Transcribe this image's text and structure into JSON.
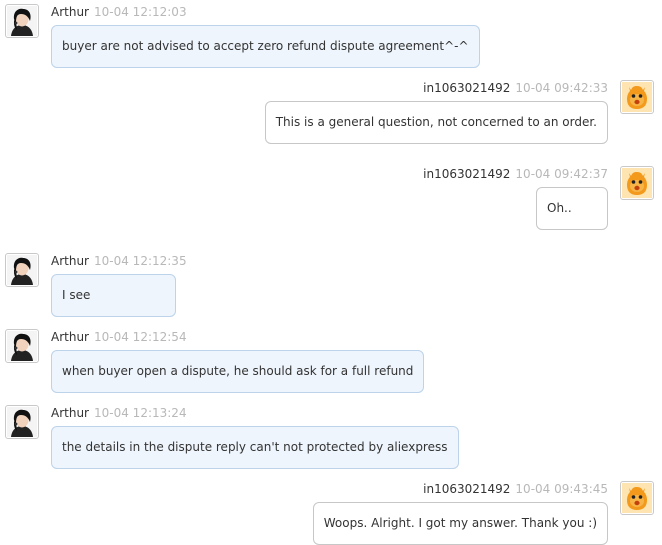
{
  "messages": [
    {
      "side": "left",
      "sender": "Arthur",
      "time": "10-04 12:12:03",
      "text": "buyer are not advised to accept zero refund dispute agreement^-^"
    },
    {
      "side": "right",
      "sender": "in1063021492",
      "time": "10-04 09:42:33",
      "text": "This is a general question, not concerned to an order."
    },
    {
      "side": "right",
      "sender": "in1063021492",
      "time": "10-04 09:42:37",
      "text": "Oh.."
    },
    {
      "side": "left",
      "sender": "Arthur",
      "time": "10-04 12:12:35",
      "text": "I see"
    },
    {
      "side": "left",
      "sender": "Arthur",
      "time": "10-04 12:12:54",
      "text": "when buyer open a dispute, he should ask for a full refund"
    },
    {
      "side": "left",
      "sender": "Arthur",
      "time": "10-04 12:13:24",
      "text": "the details in the dispute reply can't not protected by aliexpress"
    },
    {
      "side": "right",
      "sender": "in1063021492",
      "time": "10-04 09:43:45",
      "text": "Woops. Alright. I got my answer. Thank you :)"
    }
  ],
  "colors": {
    "incoming_bubble": "#eef5fc",
    "incoming_border": "#bcd3ea",
    "outgoing_bubble": "#ffffff",
    "outgoing_border": "#c7c7c7",
    "timestamp": "#b8b8b8",
    "seller_avatar": "#f39a1c"
  },
  "icons": {
    "agent_avatar": "agent-avatar-icon",
    "buyer_avatar": "orange-mascot-icon"
  }
}
